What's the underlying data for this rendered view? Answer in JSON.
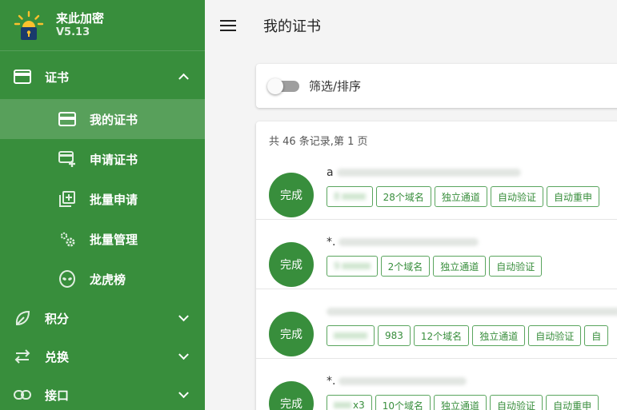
{
  "app": {
    "name": "来此加密",
    "version": "V5.13"
  },
  "nav": {
    "cert_group": {
      "label": "证书",
      "icon": "card-icon"
    },
    "cert_items": [
      {
        "label": "我的证书",
        "icon": "card-icon",
        "active": true
      },
      {
        "label": "申请证书",
        "icon": "card-add-icon"
      },
      {
        "label": "批量申请",
        "icon": "library-add-icon"
      },
      {
        "label": "批量管理",
        "icon": "settings-gears-icon"
      },
      {
        "label": "龙虎榜",
        "icon": "alien-icon"
      }
    ],
    "points_group": {
      "label": "积分",
      "icon": "leaf-icon"
    },
    "exchange_group": {
      "label": "兑换",
      "icon": "swap-icon"
    },
    "api_group": {
      "label": "接口",
      "icon": "link-icon"
    }
  },
  "header": {
    "title": "我的证书"
  },
  "filter": {
    "label": "筛选/排序",
    "enabled": false
  },
  "list": {
    "summary": "共 46 条记录,第 1 页",
    "rows": [
      {
        "status": "完成",
        "domain_prefix": "a",
        "tags": [
          "8",
          "28个域名",
          "独立通道",
          "自动验证",
          "自动重申"
        ]
      },
      {
        "status": "完成",
        "domain_prefix": "*.",
        "tags": [
          "9",
          "2个域名",
          "独立通道",
          "自动验证"
        ]
      },
      {
        "status": "完成",
        "domain_prefix": "",
        "tags": [
          "",
          "983",
          "12个域名",
          "独立通道",
          "自动验证",
          "自"
        ]
      },
      {
        "status": "完成",
        "domain_prefix": "*.",
        "tags": [
          "x3",
          "10个域名",
          "独立通道",
          "自动验证",
          "自动重申"
        ]
      }
    ]
  },
  "colors": {
    "primary": "#388e3c",
    "background": "#f4f4f4"
  }
}
